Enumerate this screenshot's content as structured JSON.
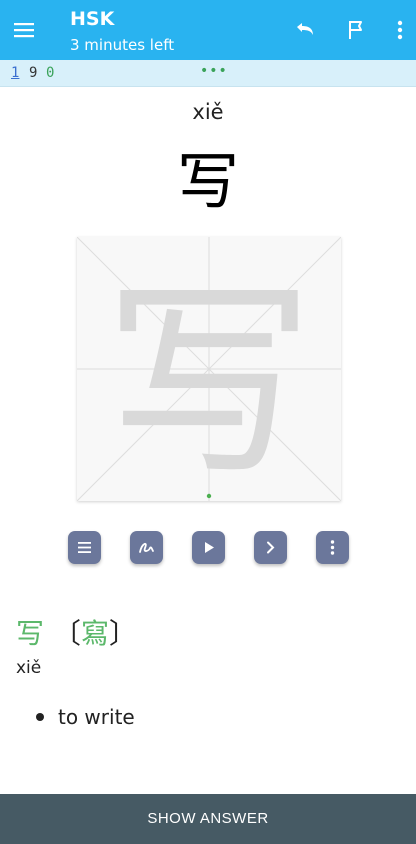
{
  "app_bar": {
    "title": "HSK",
    "subtitle": "3 minutes left",
    "icons": [
      "menu-icon",
      "undo-icon",
      "flag-icon",
      "more-vert-icon"
    ],
    "background": "#29b3f0"
  },
  "counts": {
    "new": "1",
    "learning": "9",
    "review": "0",
    "more": "•••"
  },
  "card": {
    "pinyin": "xiě",
    "character": "写",
    "writing_panel": {
      "guide_character": "写",
      "controls": [
        "list-icon",
        "stroke-icon",
        "play-icon",
        "next-icon",
        "more-vert-icon"
      ]
    },
    "entry": {
      "simplified": "写",
      "open_bracket": "〔",
      "traditional": "寫",
      "close_bracket": "〕",
      "pinyin": "xiě",
      "definitions": [
        "to write"
      ]
    }
  },
  "actions": {
    "show_answer": "SHOW ANSWER"
  },
  "colors": {
    "accent": "#29b3f0",
    "hanzi_green": "#5cb86b",
    "control_button": "#6b779b",
    "bottom_bar": "#465a64"
  }
}
